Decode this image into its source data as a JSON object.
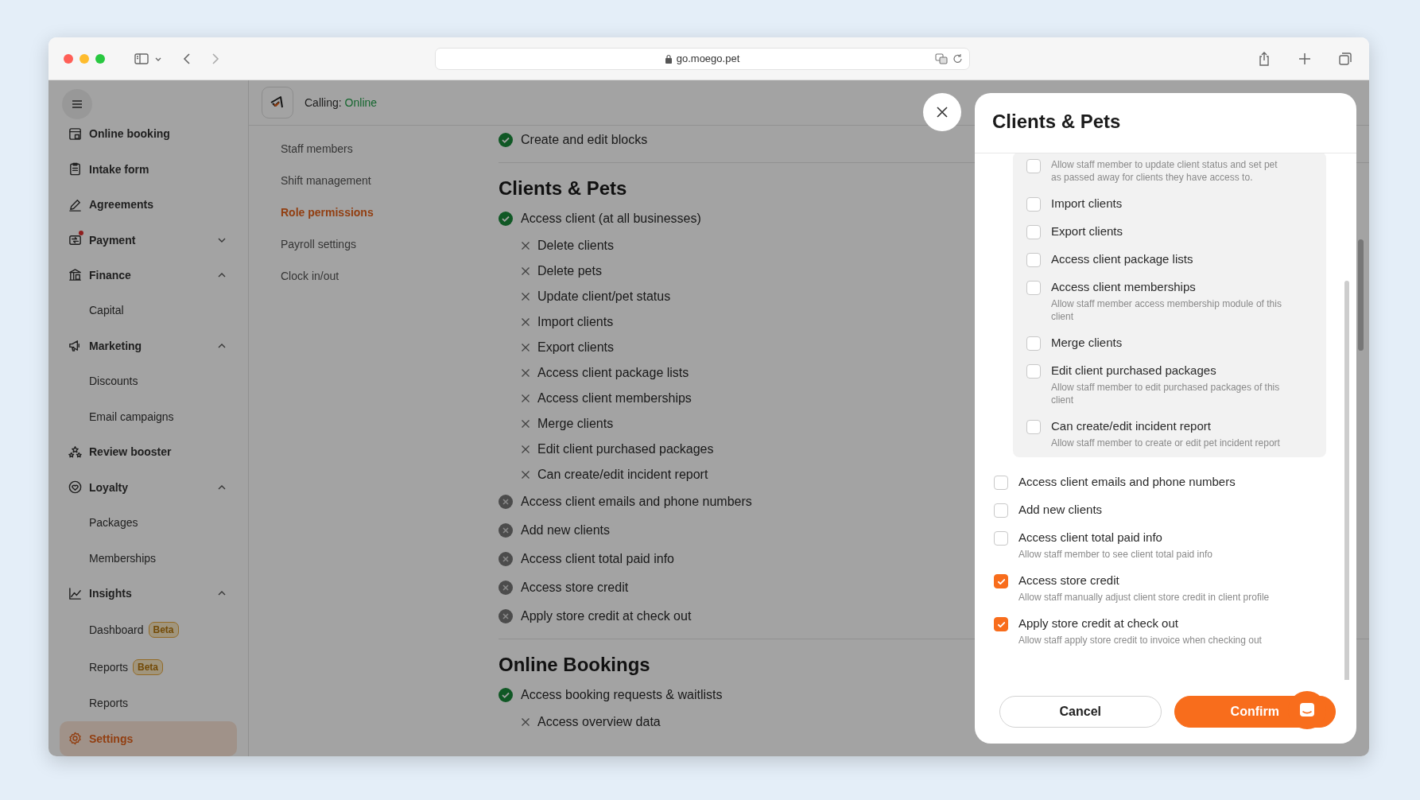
{
  "browser": {
    "url": "go.moego.pet"
  },
  "sidebar": {
    "items": [
      {
        "label": "Online booking",
        "selected": false,
        "notification": false
      },
      {
        "label": "Intake form",
        "selected": false,
        "notification": false
      },
      {
        "label": "Agreements",
        "selected": false,
        "notification": false
      },
      {
        "label": "Payment",
        "selected": false,
        "notification": true,
        "expanded": false
      },
      {
        "label": "Finance",
        "selected": false,
        "notification": false,
        "expanded": true,
        "children": [
          {
            "label": "Capital",
            "selected": false
          }
        ]
      },
      {
        "label": "Marketing",
        "selected": false,
        "notification": false,
        "expanded": true,
        "children": [
          {
            "label": "Discounts",
            "selected": false
          },
          {
            "label": "Email campaigns",
            "selected": false
          }
        ]
      },
      {
        "label": "Review booster",
        "selected": false,
        "notification": false
      },
      {
        "label": "Loyalty",
        "selected": false,
        "notification": false,
        "expanded": true,
        "children": [
          {
            "label": "Packages",
            "selected": false
          },
          {
            "label": "Memberships",
            "selected": false
          }
        ]
      },
      {
        "label": "Insights",
        "selected": false,
        "notification": false,
        "expanded": true,
        "children": [
          {
            "label": "Dashboard",
            "badge": "Beta",
            "selected": false
          },
          {
            "label": "Reports",
            "badge": "Beta",
            "selected": false
          },
          {
            "label": "Reports",
            "selected": false
          }
        ]
      },
      {
        "label": "Settings",
        "selected": true,
        "notification": false
      }
    ]
  },
  "header": {
    "calling_label": "Calling:",
    "status": "Online"
  },
  "settings_nav": [
    {
      "label": "Staff members",
      "selected": false
    },
    {
      "label": "Shift management",
      "selected": false
    },
    {
      "label": "Role permissions",
      "selected": true
    },
    {
      "label": "Payroll settings",
      "selected": false
    },
    {
      "label": "Clock in/out",
      "selected": false
    }
  ],
  "permissions": {
    "sections": [
      {
        "items": [
          {
            "label": "Create and edit blocks",
            "allowed": true
          }
        ]
      },
      {
        "title": "Clients & Pets",
        "items": [
          {
            "label": "Access client (at all businesses)",
            "allowed": true,
            "children": [
              {
                "label": "Delete clients",
                "allowed": false
              },
              {
                "label": "Delete pets",
                "allowed": false
              },
              {
                "label": "Update client/pet status",
                "allowed": false
              },
              {
                "label": "Import clients",
                "allowed": false
              },
              {
                "label": "Export clients",
                "allowed": false
              },
              {
                "label": "Access client package lists",
                "allowed": false
              },
              {
                "label": "Access client memberships",
                "allowed": false
              },
              {
                "label": "Merge clients",
                "allowed": false
              },
              {
                "label": "Edit client purchased packages",
                "allowed": false
              },
              {
                "label": "Can create/edit incident report",
                "allowed": false
              }
            ]
          },
          {
            "label": "Access client emails and phone numbers",
            "allowed": false
          },
          {
            "label": "Add new clients",
            "allowed": false
          },
          {
            "label": "Access client total paid info",
            "allowed": false
          },
          {
            "label": "Access store credit",
            "allowed": false
          },
          {
            "label": "Apply store credit at check out",
            "allowed": false
          }
        ]
      },
      {
        "title": "Online Bookings",
        "items": [
          {
            "label": "Access booking requests & waitlists",
            "allowed": true,
            "children": [
              {
                "label": "Access overview data",
                "allowed": false
              }
            ]
          }
        ]
      }
    ]
  },
  "modal": {
    "title": "Clients & Pets",
    "options": [
      {
        "kind": "group",
        "children": [
          {
            "checked": false,
            "description": "Allow staff member to update client status and set pet as passed away for clients they have access to."
          },
          {
            "label": "Import clients",
            "checked": false
          },
          {
            "label": "Export clients",
            "checked": false
          },
          {
            "label": "Access client package lists",
            "checked": false
          },
          {
            "label": "Access client memberships",
            "checked": false,
            "description": "Allow staff member access membership module of this client"
          },
          {
            "label": "Merge clients",
            "checked": false
          },
          {
            "label": "Edit client purchased packages",
            "checked": false,
            "description": "Allow staff member to edit purchased packages of this client"
          },
          {
            "label": "Can create/edit incident report",
            "checked": false,
            "description": "Allow staff member to create or edit pet incident report"
          }
        ]
      },
      {
        "kind": "option",
        "label": "Access client emails and phone numbers",
        "checked": false
      },
      {
        "kind": "option",
        "label": "Add new clients",
        "checked": false
      },
      {
        "kind": "option",
        "label": "Access client total paid info",
        "checked": false,
        "description": "Allow staff member to see client total paid info"
      },
      {
        "kind": "option",
        "label": "Access store credit",
        "checked": true,
        "description": "Allow staff manually adjust client store credit in client profile"
      },
      {
        "kind": "option",
        "label": "Apply store credit at check out",
        "checked": true,
        "description": "Allow staff apply store credit to invoice when checking out"
      }
    ],
    "buttons": [
      {
        "label": "Cancel",
        "kind": "secondary"
      },
      {
        "label": "Confirm",
        "kind": "primary"
      }
    ]
  }
}
